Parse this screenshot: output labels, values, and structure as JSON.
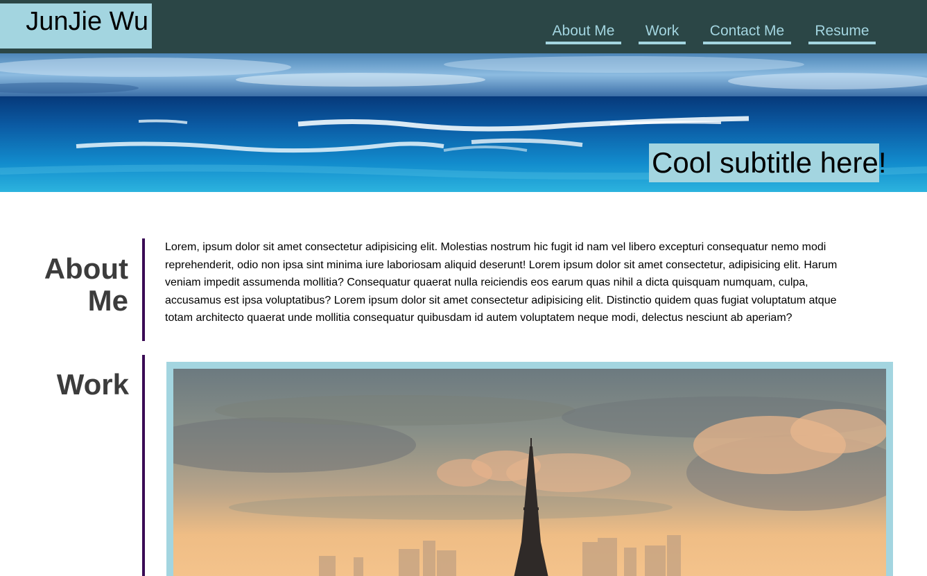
{
  "header": {
    "brand": "JunJie Wu",
    "nav": [
      {
        "label": "About Me"
      },
      {
        "label": "Work"
      },
      {
        "label": "Contact Me"
      },
      {
        "label": "Resume"
      }
    ]
  },
  "hero": {
    "subtitle": "Cool subtitle here!"
  },
  "about": {
    "title": "About Me",
    "body": "Lorem, ipsum dolor sit amet consectetur adipisicing elit. Molestias nostrum hic fugit id nam vel libero excepturi consequatur nemo modi reprehenderit, odio non ipsa sint minima iure laboriosam aliquid deserunt! Lorem ipsum dolor sit amet consectetur, adipisicing elit. Harum veniam impedit assumenda mollitia? Consequatur quaerat nulla reiciendis eos earum quas nihil a dicta quisquam numquam, culpa, accusamus est ipsa voluptatibus? Lorem ipsum dolor sit amet consectetur adipisicing elit. Distinctio quidem quas fugiat voluptatum atque totam architecto quaerat unde mollitia consequatur quibusdam id autem voluptatem neque modi, delectus nesciunt ab aperiam?"
  },
  "work": {
    "title": "Work"
  },
  "colors": {
    "header_bg": "#2b4646",
    "accent": "#a3d5e0",
    "divider": "#3a0b55",
    "heading": "#3c3c3c"
  }
}
